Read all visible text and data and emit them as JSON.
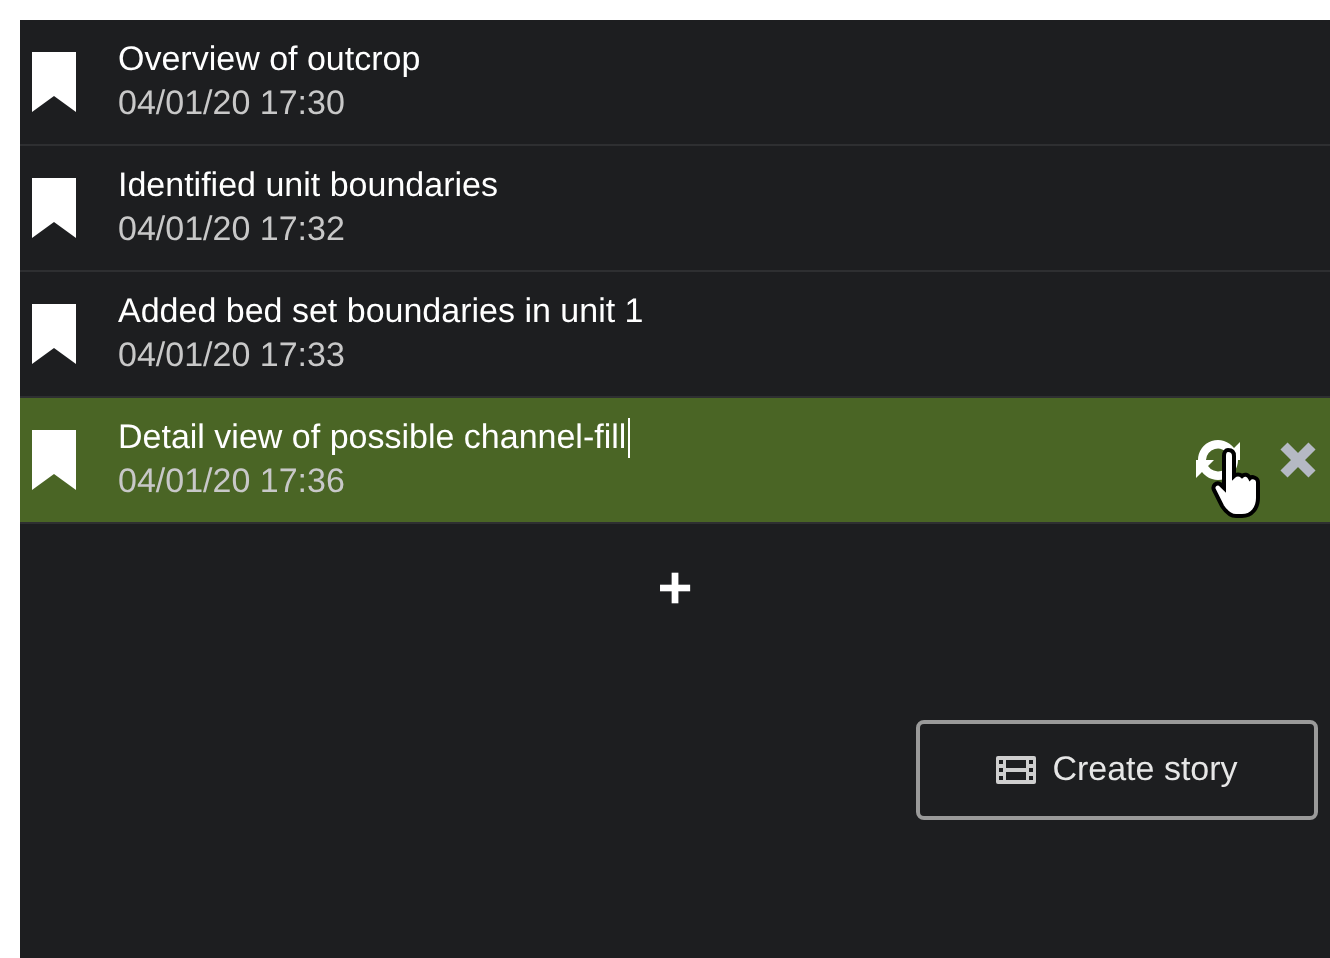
{
  "bookmarks": [
    {
      "title": "Overview of outcrop",
      "time": "04/01/20 17:30",
      "selected": false,
      "editing": false
    },
    {
      "title": "Identified unit boundaries",
      "time": "04/01/20 17:32",
      "selected": false,
      "editing": false
    },
    {
      "title": "Added bed set boundaries in unit 1",
      "time": "04/01/20 17:33",
      "selected": false,
      "editing": false
    },
    {
      "title": "Detail view of possible channel-fill",
      "time": "04/01/20 17:36",
      "selected": true,
      "editing": true
    }
  ],
  "add_button": {
    "label": "+"
  },
  "create_story_button": {
    "label": "Create story"
  }
}
